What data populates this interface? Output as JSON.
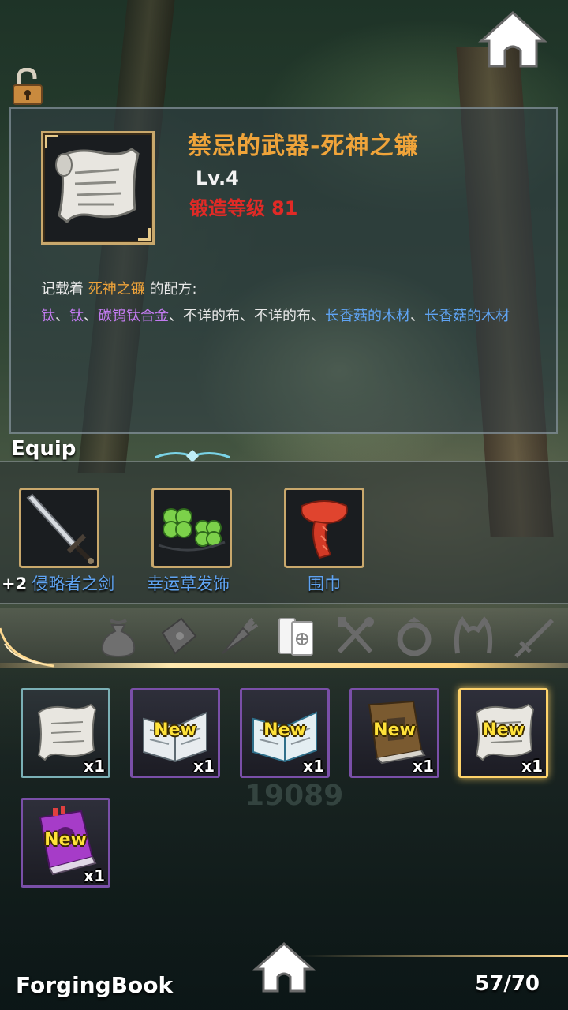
{
  "item": {
    "title": "禁忌的武器-死神之镰",
    "level": "Lv.4",
    "forge_label": "锻造等级",
    "forge_value": "81",
    "icon": "scroll-icon"
  },
  "recipe": {
    "intro": "记载着",
    "target": "死神之镰",
    "intro_suffix": "的配方:",
    "materials": [
      {
        "name": "钛",
        "color": "#c27bf0"
      },
      {
        "name": "钛",
        "color": "#c27bf0"
      },
      {
        "name": "碳钨钛合金",
        "color": "#c27bf0"
      },
      {
        "name": "不详的布",
        "color": "#e8e8e8"
      },
      {
        "name": "不详的布",
        "color": "#e8e8e8"
      },
      {
        "name": "长香菇的木材",
        "color": "#5fa3f2"
      },
      {
        "name": "长香菇的木材",
        "color": "#5fa3f2"
      }
    ],
    "separator": "、"
  },
  "equip": {
    "title": "Equip",
    "slots": [
      {
        "plus": "+2",
        "name": "侵略者之剑",
        "icon": "sword-icon"
      },
      {
        "plus": "",
        "name": "幸运草发饰",
        "icon": "clover-icon"
      },
      {
        "plus": "",
        "name": "围巾",
        "icon": "scarf-icon"
      }
    ]
  },
  "categories": [
    {
      "name": "bag-icon",
      "active": false
    },
    {
      "name": "stone-icon",
      "active": false
    },
    {
      "name": "carrot-icon",
      "active": false
    },
    {
      "name": "books-icon",
      "active": true
    },
    {
      "name": "utensils-icon",
      "active": false
    },
    {
      "name": "ring-icon",
      "active": false
    },
    {
      "name": "headband-icon",
      "active": false
    },
    {
      "name": "sword-icon",
      "active": false
    }
  ],
  "inventory": [
    {
      "icon": "scroll-icon",
      "new": false,
      "qty": "x1",
      "rarity": "teal",
      "selected": false
    },
    {
      "icon": "open-book-icon",
      "new": true,
      "qty": "x1",
      "rarity": "purple",
      "selected": false
    },
    {
      "icon": "open-book-icon",
      "new": true,
      "qty": "x1",
      "rarity": "purple",
      "selected": false
    },
    {
      "icon": "brown-book-icon",
      "new": true,
      "qty": "x1",
      "rarity": "purple",
      "selected": false
    },
    {
      "icon": "scroll-icon",
      "new": true,
      "qty": "x1",
      "rarity": "gold",
      "selected": true
    },
    {
      "icon": "purple-book-icon",
      "new": true,
      "qty": "x1",
      "rarity": "purple",
      "selected": false
    }
  ],
  "new_label": "New",
  "background_number": "19089",
  "footer": {
    "title": "ForgingBook",
    "count": "57/70"
  },
  "colors": {
    "title": "#f0a43a",
    "forge": "#e02a26",
    "rare_material": "#c27bf0",
    "wood_material": "#5fa3f2",
    "slot_border": "#c9a86c",
    "selected_border": "#ffd36a"
  }
}
